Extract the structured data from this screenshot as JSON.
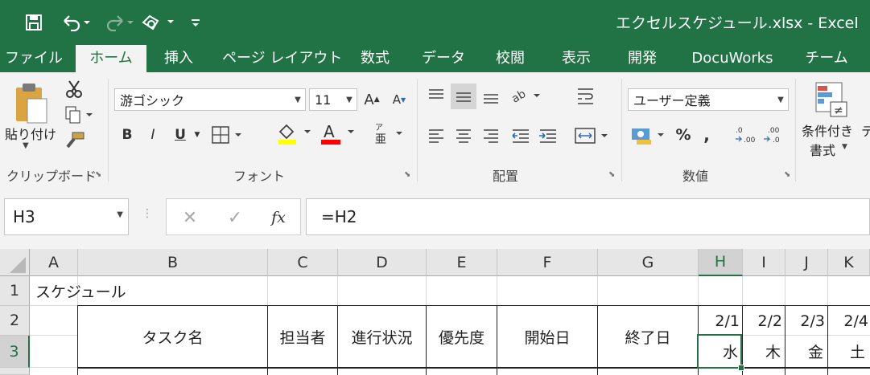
{
  "window": {
    "title": "エクセルスケジュール.xlsx  -  Excel"
  },
  "qat": {
    "save_icon": "save-icon",
    "undo_icon": "undo-icon",
    "redo_icon": "redo-icon",
    "touch_icon": "touch-mode-icon"
  },
  "tabs": [
    {
      "label": "ファイル"
    },
    {
      "label": "ホーム"
    },
    {
      "label": "挿入"
    },
    {
      "label": "ページ レイアウト"
    },
    {
      "label": "数式"
    },
    {
      "label": "データ"
    },
    {
      "label": "校閲"
    },
    {
      "label": "表示"
    },
    {
      "label": "開発"
    },
    {
      "label": "DocuWorks"
    },
    {
      "label": "チーム"
    }
  ],
  "ribbon": {
    "clipboard": {
      "paste_label": "貼り付け",
      "group_label": "クリップボード"
    },
    "font": {
      "font_name": "游ゴシック",
      "font_size": "11",
      "bold": "B",
      "italic": "I",
      "underline": "U",
      "group_label": "フォント",
      "font_color": "#ff0000",
      "highlight_color": "#ffff00"
    },
    "alignment": {
      "group_label": "配置"
    },
    "number": {
      "format": "ユーザー定義",
      "percent": "%",
      "comma": ",",
      "group_label": "数値"
    },
    "styles": {
      "conditional_label_1": "条件付き",
      "conditional_label_2": "書式"
    }
  },
  "formula_bar": {
    "name_box": "H3",
    "formula": "=H2",
    "fx": "fx"
  },
  "columns": [
    "A",
    "B",
    "C",
    "D",
    "E",
    "F",
    "G",
    "H",
    "I",
    "J",
    "K"
  ],
  "rows": [
    "1",
    "2",
    "3"
  ],
  "cells": {
    "A1": "スケジュール",
    "B2": "タスク名",
    "C2": "担当者",
    "D2": "進行状況",
    "E2": "優先度",
    "F2": "開始日",
    "G2": "終了日",
    "H2": "2/1",
    "I2": "2/2",
    "J2": "2/3",
    "K2": "2/4",
    "H3": "水",
    "I3": "木",
    "J3": "金",
    "K3": "土"
  },
  "selected_cell": "H3",
  "accent_color": "#217346"
}
